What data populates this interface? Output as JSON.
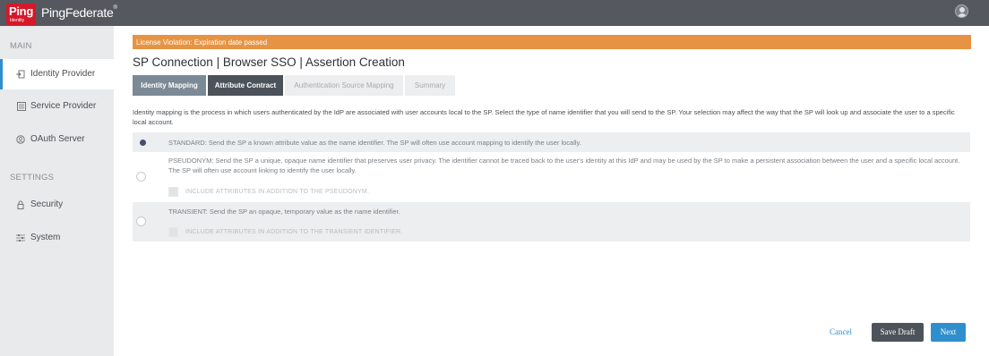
{
  "app": {
    "logo_text": "Ping",
    "logo_subtext": "Identity",
    "brand_name": "PingFederate",
    "brand_mark": "®"
  },
  "sidebar": {
    "main_section": "MAIN",
    "settings_section": "SETTINGS",
    "items": [
      {
        "label": "Identity Provider",
        "icon": "identity-provider-icon"
      },
      {
        "label": "Service Provider",
        "icon": "service-provider-icon"
      },
      {
        "label": "OAuth Server",
        "icon": "oauth-icon"
      },
      {
        "label": "Security",
        "icon": "lock-icon"
      },
      {
        "label": "System",
        "icon": "sliders-icon"
      }
    ],
    "active_index": 0
  },
  "license": {
    "text": "License Violation: Expiration date passed"
  },
  "page": {
    "title": "SP Connection | Browser SSO | Assertion Creation",
    "tabs": [
      {
        "label": "Identity Mapping",
        "state": "visited"
      },
      {
        "label": "Attribute Contract",
        "state": "active"
      },
      {
        "label": "Authentication Source Mapping",
        "state": "disabled"
      },
      {
        "label": "Summary",
        "state": "disabled"
      }
    ],
    "description": "Identity mapping is the process in which users authenticated by the IdP are associated with user accounts local to the SP. Select the type of name identifier that you will send to the SP. Your selection may affect the way that the SP will look up and associate the user to a specific local account."
  },
  "options": {
    "selected": "standard",
    "standard": {
      "text": "STANDARD: Send the SP a known attribute value as the name identifier. The SP will often use account mapping to identify the user locally."
    },
    "pseudonym": {
      "text": "PSEUDONYM: Send the SP a unique, opaque name identifier that preserves user privacy. The identifier cannot be traced back to the user's identity at this IdP and may be used by the SP to make a persistent association between the user and a specific local account. The SP will often use account linking to identify the user locally.",
      "checkbox_label": "INCLUDE ATTRIBUTES IN ADDITION TO THE PSEUDONYM."
    },
    "transient": {
      "text": "TRANSIENT: Send the SP an opaque, temporary value as the name identifier.",
      "checkbox_label": "INCLUDE ATTRIBUTES IN ADDITION TO THE TRANSIENT IDENTIFIER."
    }
  },
  "actions": {
    "cancel": "Cancel",
    "save_draft": "Save Draft",
    "next": "Next"
  },
  "colors": {
    "topbar": "#55595f",
    "accent": "#2f8fce",
    "license_banner": "#e69444",
    "brand_red": "#d5192b"
  }
}
